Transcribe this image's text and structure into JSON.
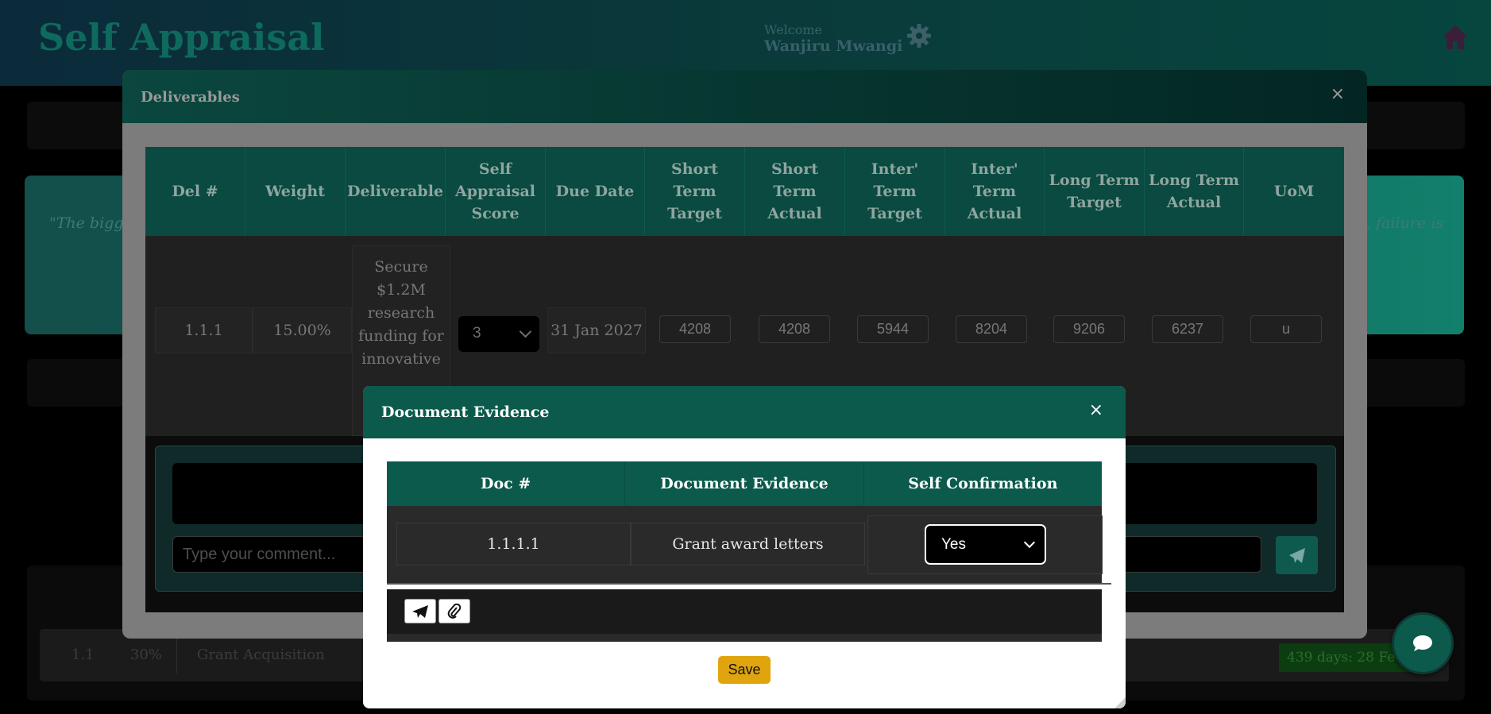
{
  "header": {
    "app_title": "Self Appraisal",
    "welcome_label": "Welcome",
    "user_name": "Wanjiru Mwangi",
    "settings_icon": "gear-icon",
    "home_icon": "home-icon"
  },
  "background": {
    "quote_left": "\"The bigge",
    "quote_right": ", failure is",
    "row": {
      "del_no": "1.1",
      "weight": "30%",
      "deliverable": "Grant Acquisition"
    },
    "days_badge": "439 days: 28 Fe"
  },
  "deliverables_modal": {
    "title": "Deliverables",
    "close": "×",
    "columns": [
      "Del #",
      "Weight",
      "Deliverable",
      "Self Appraisal Score",
      "Due Date",
      "Short Term Target",
      "Short Term Actual",
      "Inter' Term Target",
      "Inter' Term Actual",
      "Long Term Target",
      "Long Term Actual",
      "UoM"
    ],
    "row": {
      "del_no": "1.1.1",
      "weight": "15.00%",
      "deliverable": "Secure $1.2M research funding for innovative",
      "self_appraisal_score": "3",
      "due_date": "31 Jan 2027",
      "short_term_target": "4208",
      "short_term_actual": "4208",
      "inter_term_target": "5944",
      "inter_term_actual": "8204",
      "long_term_target": "9206",
      "long_term_actual": "6237",
      "uom": "u"
    },
    "comment_placeholder": "Type your comment..."
  },
  "document_modal": {
    "title": "Document Evidence",
    "close": "×",
    "columns": [
      "Doc #",
      "Document Evidence",
      "Self Confirmation"
    ],
    "row": {
      "doc_no": "1.1.1.1",
      "evidence": "Grant award letters",
      "confirmation": "Yes"
    },
    "save_label": "Save"
  },
  "colors": {
    "accent_green": "#0b5a4c",
    "save_yellow": "#e0a50e"
  }
}
